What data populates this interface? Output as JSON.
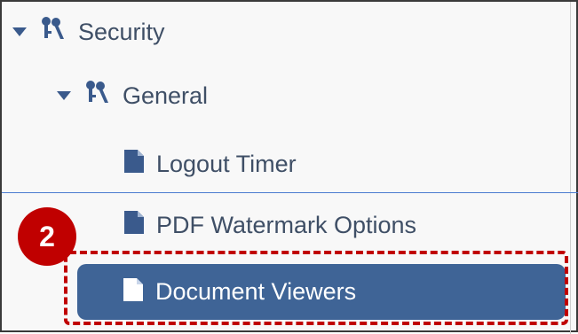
{
  "tree": {
    "items": [
      {
        "label": "Security",
        "icon": "keys-icon",
        "expanded": true
      },
      {
        "label": "General",
        "icon": "keys-icon",
        "expanded": true
      },
      {
        "label": "Logout Timer",
        "icon": "document-icon"
      },
      {
        "label": "PDF Watermark Options",
        "icon": "document-icon"
      },
      {
        "label": "Document Viewers",
        "icon": "document-icon",
        "selected": true
      }
    ]
  },
  "annotation": {
    "step_number": "2",
    "color": "#c00000"
  },
  "colors": {
    "text": "#3f4f66",
    "selected_bg": "#3f6496",
    "icon": "#3a5a8c"
  }
}
